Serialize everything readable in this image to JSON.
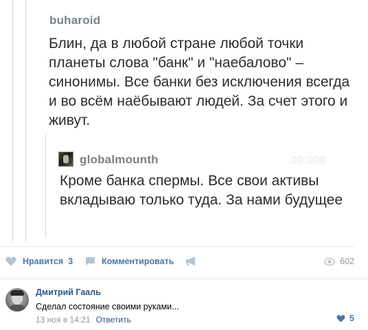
{
  "post": {
    "user1": "buharoid",
    "text1": "Блин, да в любой стране любой точки планеты слова \"банк\" и \"наебалово\" – синонимы. Все банки без исключения всегда и во всём наёбывают людей. За счет этого и живут.",
    "user2": "globalmounth",
    "text2": "Кроме банка спермы. Все свои активы вкладываю только туда. За нами будущее",
    "ghost": "00:000"
  },
  "actions": {
    "like_label": "Нравится",
    "like_count": "3",
    "comment_label": "Комментировать",
    "views": "602"
  },
  "comment": {
    "author": "Дмитрий Гааль",
    "text": "Сделал состояние своими руками...",
    "date": "13 ноя в 14:21",
    "reply": "Ответить",
    "likes": "5"
  },
  "colors": {
    "link": "#2a5885",
    "accent": "#4a76a8",
    "muted": "#939393"
  }
}
